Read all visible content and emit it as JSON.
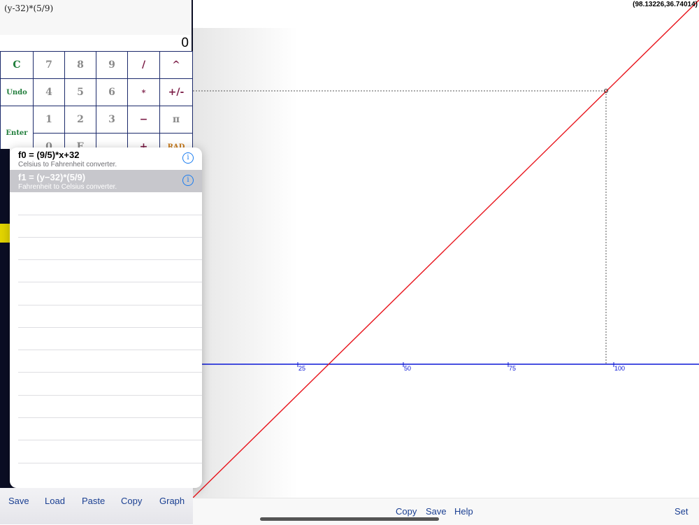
{
  "calculator": {
    "expression": "(y-32)*(5/9)",
    "display_value": "0",
    "keys": {
      "clear": "C",
      "undo": "Undo",
      "enter": "Enter",
      "k7": "7",
      "k8": "8",
      "k9": "9",
      "divide": "/",
      "power": "^",
      "k4": "4",
      "k5": "5",
      "k6": "6",
      "multiply": "*",
      "plus_minus": "+/-",
      "k1": "1",
      "k2": "2",
      "k3": "3",
      "minus": "−",
      "pi": "π",
      "k0": "0",
      "exp": "E",
      "plus": "+",
      "rad": "RAD"
    }
  },
  "function_list": {
    "items": [
      {
        "formula": "f0 = (9/5)*x+32",
        "description": "Celsius to Fahrenheit converter.",
        "selected": false
      },
      {
        "formula": "f1 = (y−32)*(5/9)",
        "description": "Fahrenheit to Celsius converter.",
        "selected": true
      }
    ]
  },
  "calc_toolbar": {
    "save": "Save",
    "load": "Load",
    "paste": "Paste",
    "copy": "Copy",
    "graph": "Graph"
  },
  "graph": {
    "coordinate_readout": "(98.13226,36.74014)",
    "x_ticks": [
      "25",
      "50",
      "75",
      "100"
    ],
    "axis_color": "#0b17d6",
    "line_color": "#e8141c"
  },
  "graph_toolbar": {
    "copy": "Copy",
    "save": "Save",
    "help": "Help",
    "set": "Set"
  }
}
